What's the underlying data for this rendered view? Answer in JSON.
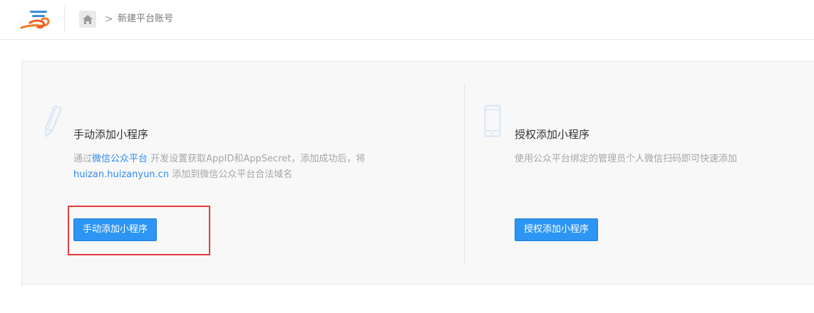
{
  "header": {
    "logo_icon": "brand-logo-icon",
    "home_icon": "home-icon",
    "breadcrumb_separator": ">",
    "breadcrumb_current": "新建平台账号"
  },
  "manual_card": {
    "icon": "pencil-icon",
    "title": "手动添加小程序",
    "desc_prefix": "通过",
    "desc_link": "微信公众平台",
    "desc_middle": " 开发设置获取AppID和AppSecret，添加成功后，将",
    "desc_domain": "huizan.huizanyun.cn",
    "desc_suffix": " 添加到微信公众平台合法域名",
    "button_label": "手动添加小程序"
  },
  "auth_card": {
    "icon": "phone-icon",
    "title": "授权添加小程序",
    "desc": "使用公众平台绑定的管理员个人微信扫码即可快速添加",
    "button_label": "授权添加小程序"
  },
  "colors": {
    "primary": "#2d95f3",
    "link": "#2d8cf0",
    "highlight": "#e23c3c",
    "panel_bg": "#f8f8f8"
  }
}
